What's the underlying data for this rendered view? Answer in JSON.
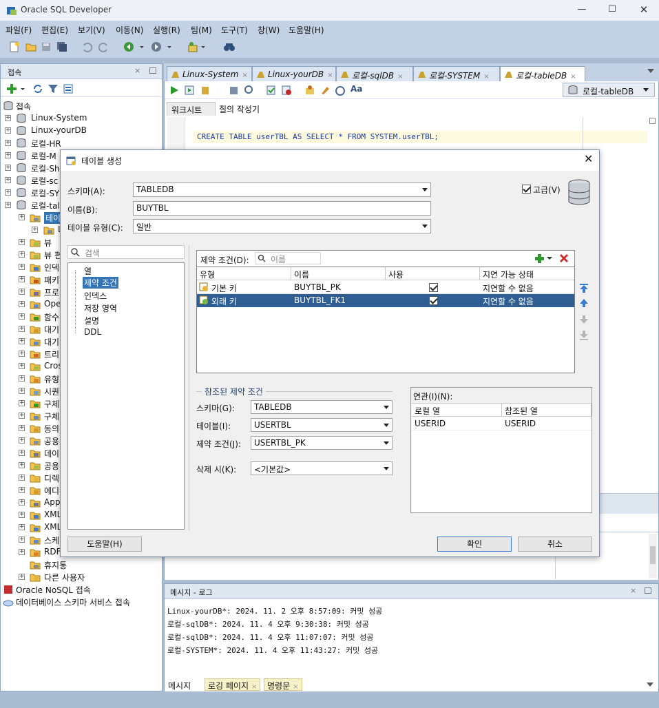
{
  "window": {
    "title": "Oracle SQL Developer"
  },
  "menu": [
    "파일(F)",
    "편집(E)",
    "보기(V)",
    "이동(N)",
    "실행(R)",
    "팀(M)",
    "도구(T)",
    "창(W)",
    "도움말(H)"
  ],
  "connections_panel": {
    "title": "접속",
    "root": "접속",
    "items": [
      "Linux-System",
      "Linux-yourDB",
      "로컬-HR",
      "로컬-M",
      "로컬-Sh",
      "로컬-sc",
      "로컬-SY",
      "로컬-tal"
    ],
    "children": [
      "테이",
      "L",
      "뷰",
      "뷰 편",
      "인덱",
      "패키",
      "프로",
      "Ope",
      "함수",
      "대기",
      "대기",
      "트리",
      "Cros",
      "유형",
      "시퀀",
      "구체",
      "구체",
      "동의",
      "공용",
      "데이",
      "공용",
      "디렉",
      "에디",
      "Appl",
      "XML",
      "XML",
      "스케",
      "RDF",
      "휴지통",
      "다른 사용자"
    ],
    "bottom": [
      "Oracle NoSQL 접속",
      "데이터베이스 스키마 서비스 접속"
    ]
  },
  "editor": {
    "tabs": [
      "Linux-System",
      "Linux-yourDB",
      "로컬-sqlDB",
      "로컬-SYSTEM",
      "로컬-tableDB"
    ],
    "connection_selector": "로컬-tableDB",
    "sub_tabs": [
      "워크시트",
      "질의 작성기"
    ],
    "sql": "CREATE TABLE userTBL AS SELECT * FROM SYSTEM.userTBL;"
  },
  "messages": {
    "title": "메시지 - 로그",
    "lines": [
      "Linux-yourDB*: 2024. 11. 2 오후 8:57:09: 커밋 성공",
      "로컬-sqlDB*: 2024. 11. 4 오후 9:30:38: 커밋 성공",
      "로컬-sqlDB*: 2024. 11. 4 오후 11:07:07: 커밋 성공",
      "로컬-SYSTEM*: 2024. 11. 4 오후 11:43:27: 커밋 성공"
    ],
    "tabs": [
      "메시지",
      "로깅 페이지",
      "명령문"
    ]
  },
  "dialog": {
    "title": "테이블 생성",
    "schema_label": "스키마(A):",
    "schema_value": "TABLEDB",
    "name_label": "이름(B):",
    "name_value": "BUYTBL",
    "type_label": "테이블 유형(C):",
    "type_value": "일반",
    "advanced_label": "고급(V)",
    "search_placeholder": "검색",
    "nav": [
      "열",
      "제약 조건",
      "인덱스",
      "저장 영역",
      "설명",
      "DDL"
    ],
    "constraints_label": "제약 조건(D):",
    "constraints_search_placeholder": "이름",
    "constraint_columns": [
      "유형",
      "이름",
      "사용",
      "지연 가능 상태"
    ],
    "constraint_rows": [
      {
        "type": "기본 키",
        "name": "BUYTBL_PK",
        "deferrable": "지연할 수 없음"
      },
      {
        "type": "외래 키",
        "name": "BUYTBL_FK1",
        "deferrable": "지연할 수 없음"
      }
    ],
    "ref_title": "참조된 제약 조건",
    "ref_schema_label": "스키마(G):",
    "ref_schema_value": "TABLEDB",
    "ref_table_label": "테이블(I):",
    "ref_table_value": "USERTBL",
    "ref_constraint_label": "제약 조건(J):",
    "ref_constraint_value": "USERTBL_PK",
    "on_delete_label": "삭제 시(K):",
    "on_delete_value": "<기본값>",
    "assoc_label": "연관(I)(N):",
    "assoc_columns": [
      "로컬 열",
      "참조된 열"
    ],
    "assoc_row": [
      "USERID",
      "USERID"
    ],
    "help_button": "도움말(H)",
    "ok_button": "확인",
    "cancel_button": "취소"
  }
}
